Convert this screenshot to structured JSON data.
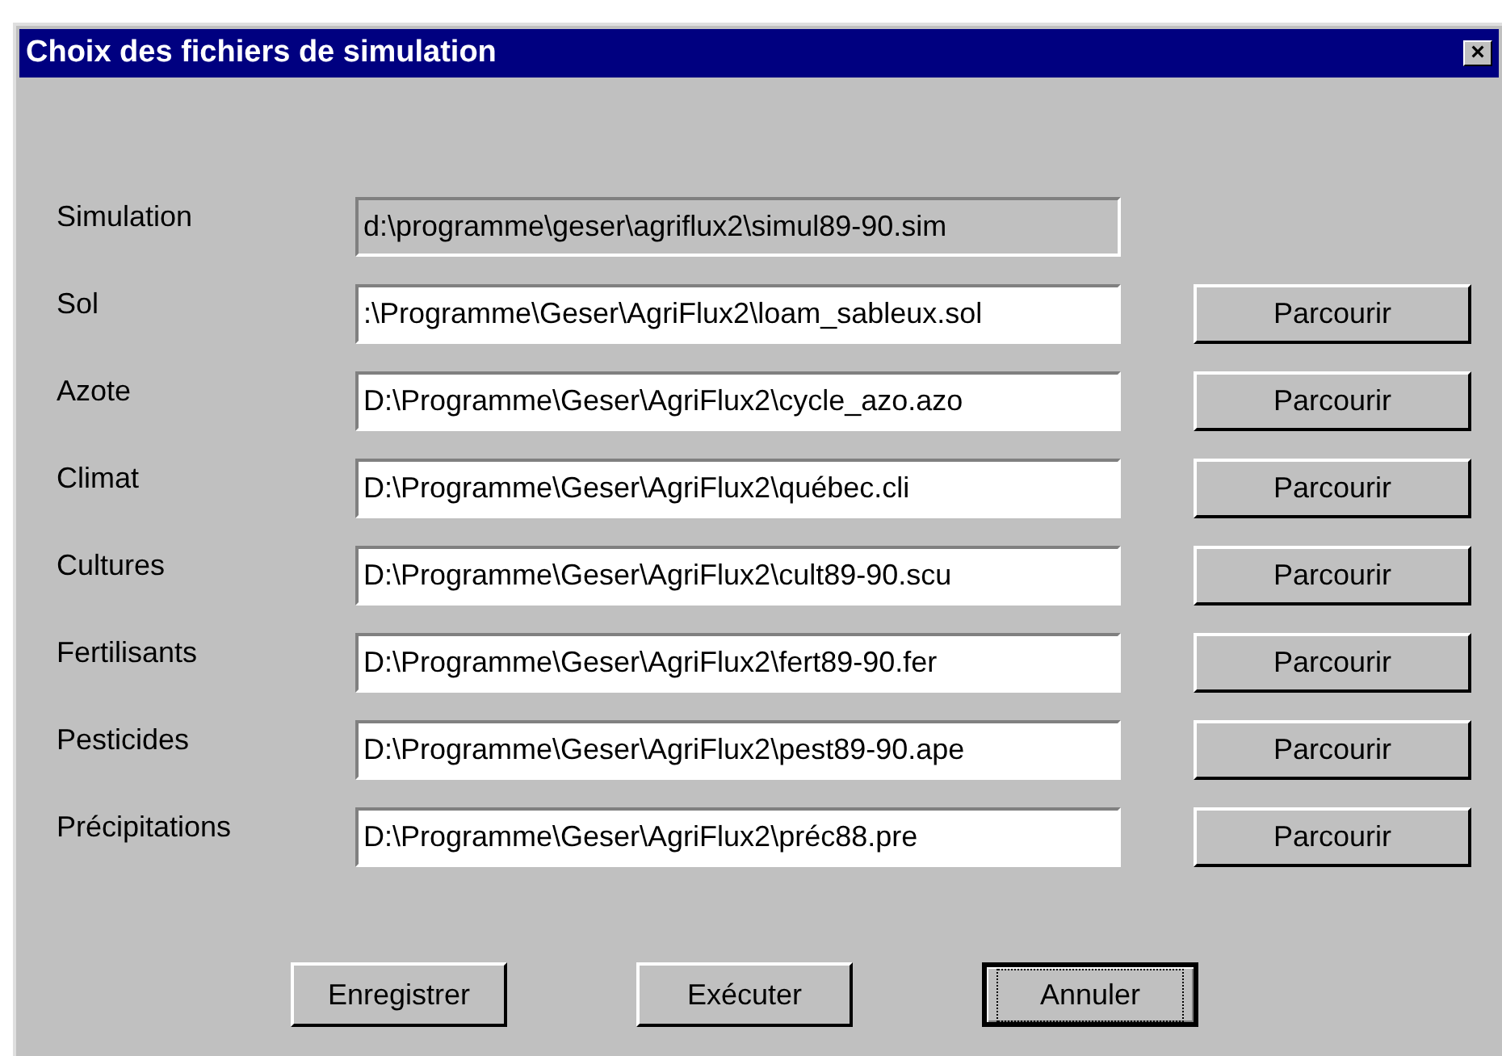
{
  "window": {
    "title": "Choix des fichiers de simulation",
    "close": "×"
  },
  "rows": [
    {
      "label": "Simulation",
      "value": "d:\\programme\\geser\\agriflux2\\simul89-90.sim",
      "disabled": true
    },
    {
      "label": "Sol",
      "value": ":\\Programme\\Geser\\AgriFlux2\\loam_sableux.sol",
      "disabled": false,
      "button": "Parcourir"
    },
    {
      "label": "Azote",
      "value": "D:\\Programme\\Geser\\AgriFlux2\\cycle_azo.azo",
      "disabled": false,
      "button": "Parcourir"
    },
    {
      "label": "Climat",
      "value": "D:\\Programme\\Geser\\AgriFlux2\\québec.cli",
      "disabled": false,
      "button": "Parcourir"
    },
    {
      "label": "Cultures",
      "value": "D:\\Programme\\Geser\\AgriFlux2\\cult89-90.scu",
      "disabled": false,
      "button": "Parcourir"
    },
    {
      "label": "Fertilisants",
      "value": "D:\\Programme\\Geser\\AgriFlux2\\fert89-90.fer",
      "disabled": false,
      "button": "Parcourir"
    },
    {
      "label": "Pesticides",
      "value": "D:\\Programme\\Geser\\AgriFlux2\\pest89-90.ape",
      "disabled": false,
      "button": "Parcourir"
    },
    {
      "label": "Précipitations",
      "value": "D:\\Programme\\Geser\\AgriFlux2\\préc88.pre",
      "disabled": false,
      "button": "Parcourir"
    }
  ],
  "buttons": [
    {
      "label": "Enregistrer",
      "focused": false
    },
    {
      "label": "Exécuter",
      "focused": false
    },
    {
      "label": "Annuler",
      "focused": true
    }
  ]
}
